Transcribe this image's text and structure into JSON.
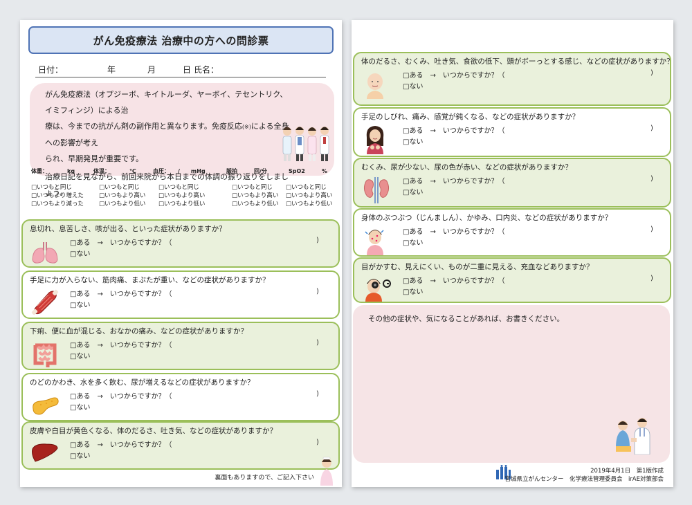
{
  "left": {
    "title": "がん免疫療法 治療中の方への問診票",
    "date_line": {
      "date_label": "日付：",
      "year": "年",
      "month": "月",
      "day": "日",
      "name_label": "氏名："
    },
    "intro": {
      "line1": "がん免疫療法（オプジーボ、キイトルーダ、ヤーボイ、テセントリク、イミフィンジ）による治",
      "line2a": "療は、今までの抗がん剤の副作用と異なります。免疫反応",
      "line2_mark": "(※)",
      "line2b": "による全身への影響が考え",
      "line3": "られ、早期発見が重要です。",
      "line4": "治療日記を見ながら、前回来院から本日までの体調の振り返りをしましょう。"
    },
    "vitals": [
      {
        "label": "体重：　　　　kg",
        "options": [
          "□いつもと同じ",
          "□いつもより増えた",
          "□いつもより減った"
        ]
      },
      {
        "label": "体温：　　　　℃",
        "options": [
          "□いつもと同じ",
          "□いつもより高い",
          "□いつもより低い"
        ]
      },
      {
        "label": "血圧：　　/　　mHg",
        "options": [
          "□いつもと同じ",
          "□いつもより高い",
          "□いつもより低い"
        ]
      },
      {
        "label": "脈拍　　　回/分",
        "options": [
          "□いつもと同じ",
          "□いつもより高い",
          "□いつもより低い"
        ]
      },
      {
        "label": "SpO2　　　%",
        "options": [
          "□いつもと同じ",
          "□いつもより高い",
          "□いつもより低い"
        ]
      }
    ],
    "questions": [
      {
        "text": "息切れ、息苦しさ、咳が出る、といった症状がありますか？",
        "icon": "lungs-icon"
      },
      {
        "text": "手足に力が入らない、筋肉痛、まぶたが重い、などの症状がありますか？",
        "icon": "muscle-icon"
      },
      {
        "text": "下痢、便に血が混じる、おなかの痛み、などの症状がありますか？",
        "icon": "intestine-icon"
      },
      {
        "text": "のどのかわき、水を多く飲む、尿が増えるなどの症状がありますか？",
        "icon": "pancreas-icon"
      },
      {
        "text": "皮膚や白目が黄色くなる、体のだるさ、吐き気、などの症状がありますか？",
        "icon": "liver-icon"
      }
    ],
    "footer": "裏面もありますので、ご記入下さい"
  },
  "right": {
    "questions": [
      {
        "text": "体のだるさ、むくみ、吐き気、食欲の低下、頭がボーっとする感じ、などの症状がありますか？",
        "icon": "bald-person-icon"
      },
      {
        "text": "手足のしびれ、痛み、感覚が鈍くなる、などの症状がありますか？",
        "icon": "woman-icon"
      },
      {
        "text": "むくみ、尿が少ない、尿の色が赤い、などの症状がありますか？",
        "icon": "kidney-icon"
      },
      {
        "text": "身体のぶつぶつ（じんましん）、かゆみ、口内炎、などの症状がありますか？",
        "icon": "itchy-person-icon"
      },
      {
        "text": "目がかすむ、見えにくい、ものが二重に見える、充血などありますか？",
        "icon": "eye-test-icon"
      }
    ],
    "other_text": "その他の症状や、気になることがあれば、お書きください。",
    "date_made": "2019年4月1日　第1版作成",
    "org": "宮城県立がんセンター　化学療法管理委員会　irAE対策部会"
  },
  "answer": {
    "yes": "□ある",
    "arrow": "→",
    "since": "いつからですか？（",
    "close": ")",
    "no": "□ない"
  },
  "colors": {
    "title_border": "#4f73b5",
    "title_bg": "#dbe5f4",
    "box_border": "#9bbf5a",
    "box_green_bg": "#eaf1dc",
    "pink_bg": "#f7e3e6"
  }
}
